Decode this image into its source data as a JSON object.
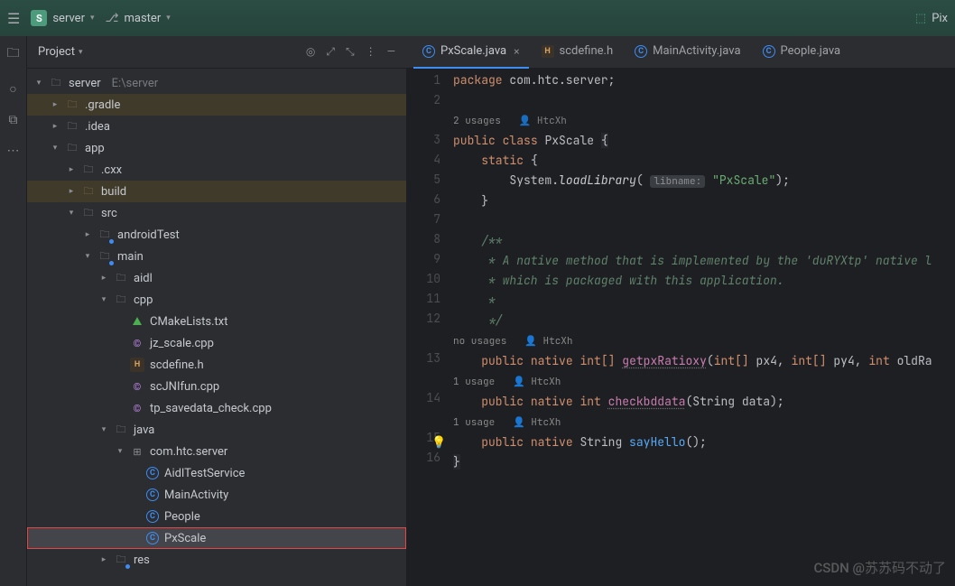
{
  "topbar": {
    "project_badge": "S",
    "project_name": "server",
    "branch": "master",
    "right_label": "Pix"
  },
  "panel": {
    "title": "Project",
    "root": {
      "label": "server",
      "path": "E:\\server"
    },
    "tree": [
      {
        "level": 0,
        "arrow": "open",
        "icon": "folder",
        "label": "server",
        "path": "E:\\server",
        "highlighted": false
      },
      {
        "level": 1,
        "arrow": "closed",
        "icon": "folder-pkg",
        "label": ".gradle",
        "highlighted": "yellow"
      },
      {
        "level": 1,
        "arrow": "closed",
        "icon": "folder",
        "label": ".idea"
      },
      {
        "level": 1,
        "arrow": "open",
        "icon": "folder",
        "label": "app"
      },
      {
        "level": 2,
        "arrow": "closed",
        "icon": "folder",
        "label": ".cxx"
      },
      {
        "level": 2,
        "arrow": "closed",
        "icon": "folder-pkg",
        "label": "build",
        "highlighted": "yellow"
      },
      {
        "level": 2,
        "arrow": "open",
        "icon": "folder",
        "label": "src"
      },
      {
        "level": 3,
        "arrow": "closed",
        "icon": "folder-src",
        "label": "androidTest"
      },
      {
        "level": 3,
        "arrow": "open",
        "icon": "folder-src",
        "label": "main"
      },
      {
        "level": 4,
        "arrow": "closed",
        "icon": "folder",
        "label": "aidl"
      },
      {
        "level": 4,
        "arrow": "open",
        "icon": "folder",
        "label": "cpp"
      },
      {
        "level": 5,
        "arrow": "none",
        "icon": "cmake",
        "label": "CMakeLists.txt"
      },
      {
        "level": 5,
        "arrow": "none",
        "icon": "cpp",
        "label": "jz_scale.cpp"
      },
      {
        "level": 5,
        "arrow": "none",
        "icon": "h",
        "label": "scdefine.h"
      },
      {
        "level": 5,
        "arrow": "none",
        "icon": "cpp",
        "label": "scJNIfun.cpp"
      },
      {
        "level": 5,
        "arrow": "none",
        "icon": "cpp",
        "label": "tp_savedata_check.cpp"
      },
      {
        "level": 4,
        "arrow": "open",
        "icon": "folder",
        "label": "java"
      },
      {
        "level": 5,
        "arrow": "open",
        "icon": "package",
        "label": "com.htc.server"
      },
      {
        "level": 6,
        "arrow": "none",
        "icon": "class",
        "label": "AidlTestService"
      },
      {
        "level": 6,
        "arrow": "none",
        "icon": "class",
        "label": "MainActivity"
      },
      {
        "level": 6,
        "arrow": "none",
        "icon": "class",
        "label": "People"
      },
      {
        "level": 6,
        "arrow": "none",
        "icon": "class",
        "label": "PxScale",
        "selected": true,
        "redbox": true
      },
      {
        "level": 4,
        "arrow": "closed",
        "icon": "folder-src",
        "label": "res"
      }
    ]
  },
  "tabs": [
    {
      "icon": "class",
      "label": "PxScale.java",
      "active": true,
      "closable": true
    },
    {
      "icon": "h",
      "label": "scdefine.h",
      "active": false
    },
    {
      "icon": "class",
      "label": "MainActivity.java",
      "active": false
    },
    {
      "icon": "class",
      "label": "People.java",
      "active": false
    }
  ],
  "code": {
    "package_kw": "package",
    "package_name": "com.htc.server",
    "usages_1": "2 usages",
    "author_1": "HtcXh",
    "public": "public",
    "class_kw": "class",
    "class_name": "PxScale",
    "static_kw": "static",
    "loadlib": "System.loadLibrary(",
    "libname_hint": "libname:",
    "libname_val": "\"PxScale\"",
    "comment_1": "/**",
    "comment_2": " * A native method that is implemented by the 'duRYXtp' native l",
    "comment_3": " * which is packaged with this application.",
    "comment_4": " *",
    "comment_5": " */",
    "no_usages": "no usages",
    "native": "native",
    "int_arr": "int[]",
    "int_t": "int",
    "getpx": "getpxRatioxy",
    "px4": "px4",
    "py4": "py4",
    "oldra": "oldRa",
    "usage_1": "1 usage",
    "checkbd": "checkbddata",
    "string_t": "String",
    "data_p": "data",
    "sayHello": "sayHello",
    "lines": [
      1,
      2,
      "",
      3,
      4,
      5,
      6,
      7,
      8,
      9,
      10,
      11,
      12,
      "",
      13,
      "",
      14,
      "",
      15,
      16
    ]
  },
  "watermark": "CSDN @苏苏码不动了"
}
